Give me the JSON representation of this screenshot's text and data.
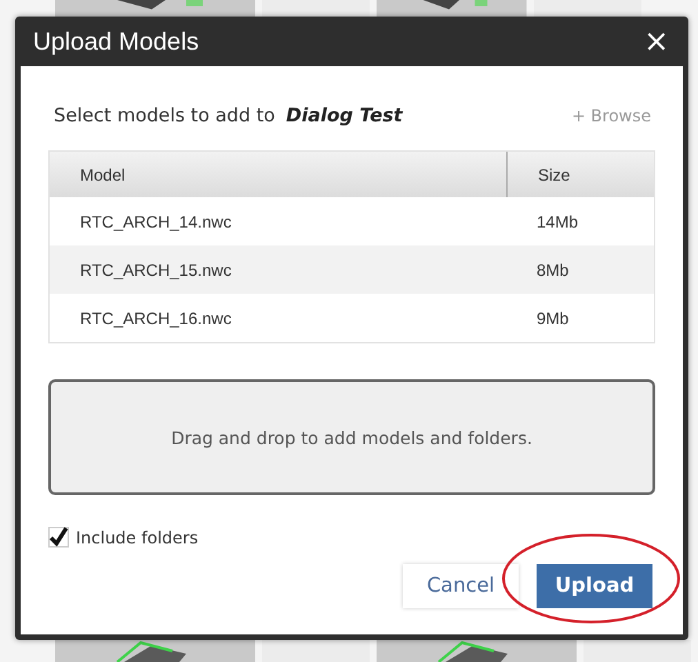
{
  "dialog": {
    "title": "Upload Models",
    "close": "×"
  },
  "prompt": {
    "text": "Select models to add to",
    "project": "Dialog Test"
  },
  "browse": "+ Browse",
  "table": {
    "columns": [
      "Model",
      "Size"
    ],
    "rows": [
      {
        "model": "RTC_ARCH_14.nwc",
        "size": "14Mb"
      },
      {
        "model": "RTC_ARCH_15.nwc",
        "size": "8Mb"
      },
      {
        "model": "RTC_ARCH_16.nwc",
        "size": "9Mb"
      }
    ]
  },
  "dropzone": "Drag and drop to add models and folders.",
  "include_folders": {
    "label": "Include folders",
    "checked": true
  },
  "buttons": [
    {
      "label": "Cancel",
      "kind": "secondary"
    },
    {
      "label": "Upload",
      "kind": "primary",
      "highlighted": true
    }
  ]
}
